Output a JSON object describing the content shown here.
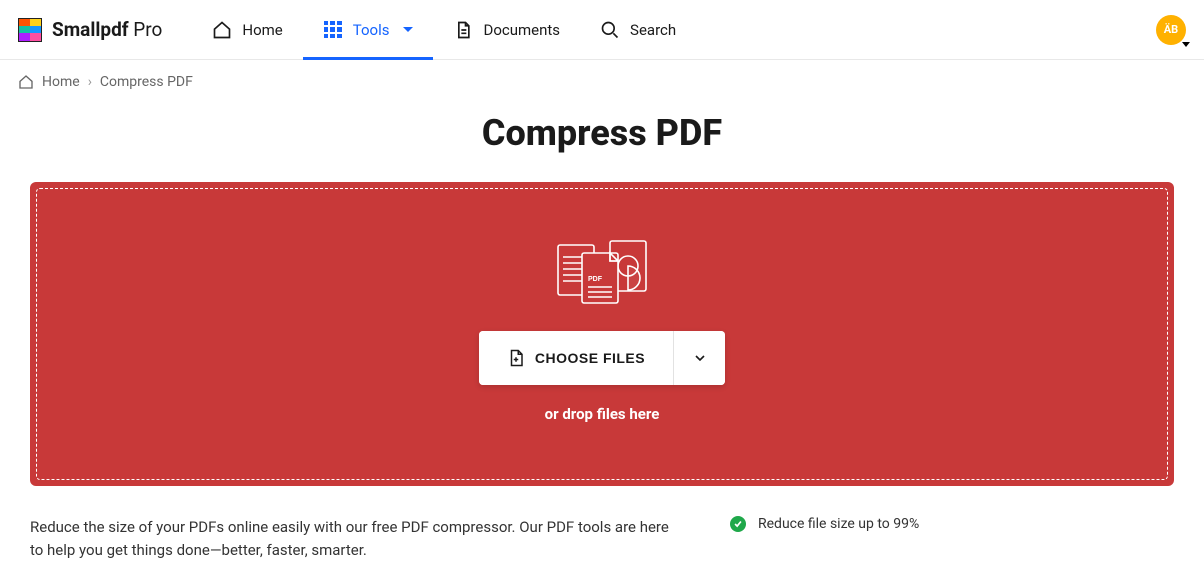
{
  "brand": {
    "name": "Smallpdf",
    "tier": "Pro"
  },
  "accent_color": "#1564ff",
  "dropzone_color": "#c83939",
  "nav": {
    "home": "Home",
    "tools": "Tools",
    "documents": "Documents",
    "search": "Search",
    "active": "tools"
  },
  "avatar": {
    "initials": "ÄB"
  },
  "breadcrumb": {
    "home": "Home",
    "current": "Compress PDF"
  },
  "page_title": "Compress PDF",
  "upload": {
    "choose_label": "CHOOSE FILES",
    "drop_label": "or drop files here"
  },
  "description": "Reduce the size of your PDFs online easily with our free PDF compressor. Our PDF tools are here to help you get things done—better, faster, smarter.",
  "features": [
    "Reduce file size up to 99%"
  ]
}
